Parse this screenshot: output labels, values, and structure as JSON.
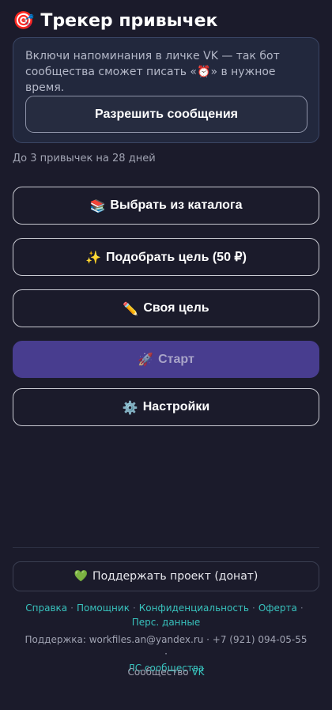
{
  "header": {
    "icon": "dart-target-icon",
    "icon_glyph": "🎯",
    "title": "Трекер привычек"
  },
  "notice": {
    "text_before": "Включи напоминания в личке VK — так бот сообщества сможет писать «",
    "alarm_glyph": "⏰",
    "text_after": "» в нужное время.",
    "button_label": "Разрешить сообщения"
  },
  "limit_text": "До 3 привычек на 28 дней",
  "actions": {
    "catalog": {
      "icon": "books-icon",
      "glyph": "📚",
      "label": "Выбрать из каталога"
    },
    "pick_goal": {
      "icon": "sparkles-icon",
      "glyph": "✨",
      "label": "Подобрать цель (50 ₽)"
    },
    "own_goal": {
      "icon": "pencil-icon",
      "glyph": "✏️",
      "label": "Своя цель"
    },
    "start": {
      "icon": "rocket-icon",
      "glyph": "🚀",
      "label": "Старт"
    },
    "settings": {
      "icon": "gear-icon",
      "glyph": "⚙️",
      "label": "Настройки"
    }
  },
  "donate": {
    "icon": "green-heart-icon",
    "glyph": "💚",
    "label": "Поддержать проект (донат)"
  },
  "footer": {
    "links": [
      "Справка",
      "Помощник",
      "Конфиденциальность",
      "Оферта",
      "Перс. данные"
    ],
    "separator": "·",
    "support_prefix": "Поддержка: workfiles.an@yandex.ru · +7 (921) 094-05-55 ·",
    "support_link": "ЛС сообщества",
    "community_prefix": "Сообщество",
    "community_link": "VK"
  },
  "colors": {
    "background": "#1b1b2b",
    "accent_start": "#483d8f",
    "link": "#38c2bd"
  }
}
